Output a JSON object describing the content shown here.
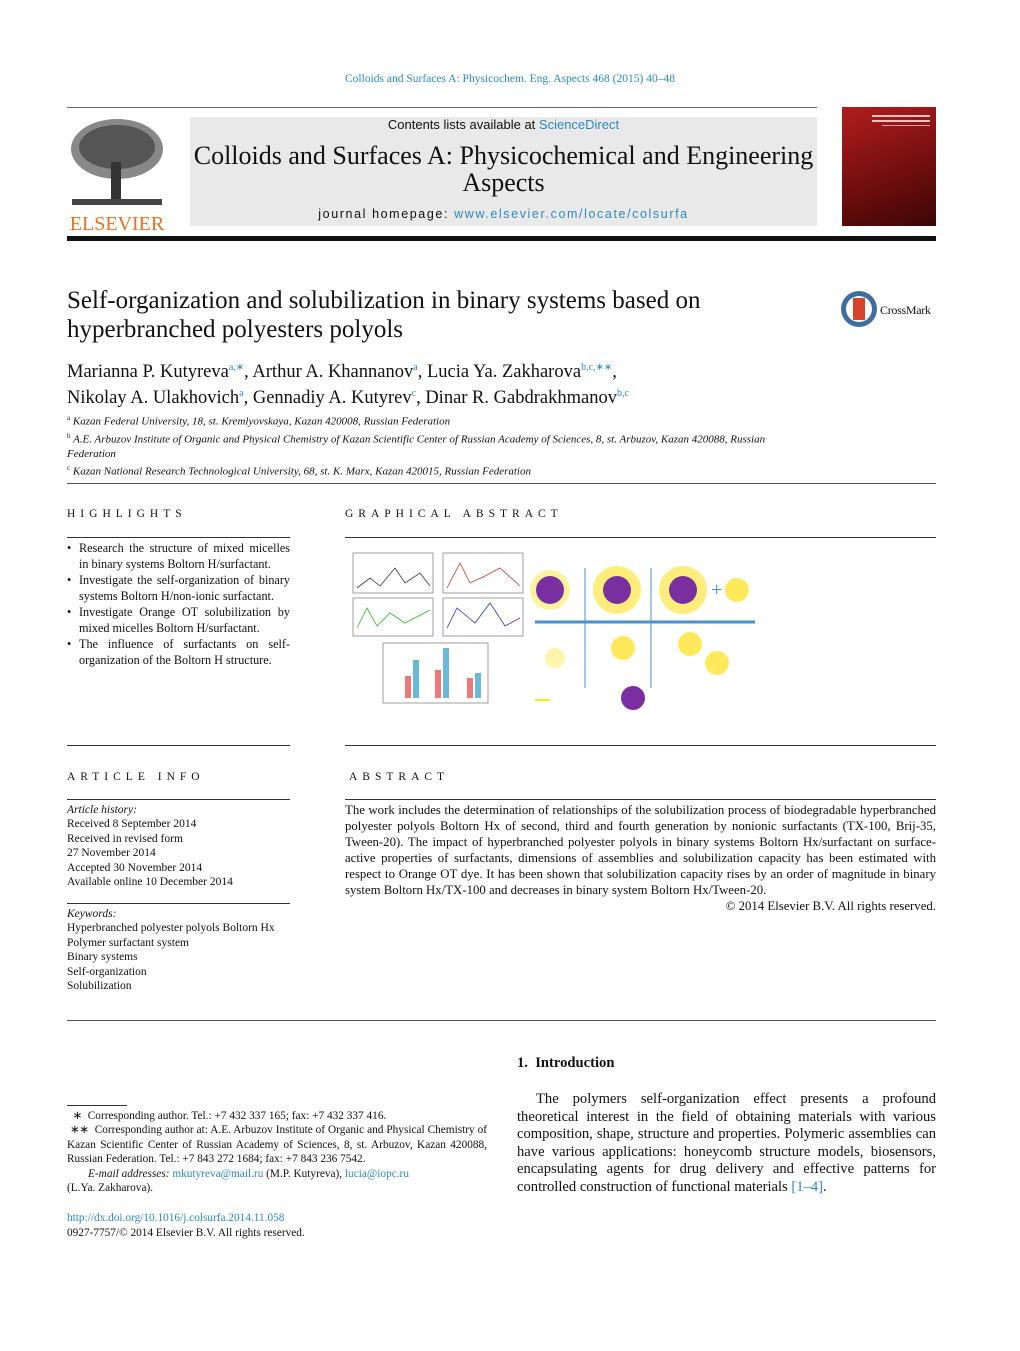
{
  "citation": "Colloids and Surfaces A: Physicochem. Eng. Aspects 468 (2015) 40–48",
  "header": {
    "contents_prefix": "Contents lists available at ",
    "sciencedirect": "ScienceDirect",
    "journal_title": "Colloids and Surfaces A: Physicochemical and Engineering Aspects",
    "homepage_prefix": "journal homepage: ",
    "homepage_url": "www.elsevier.com/locate/colsurfa",
    "publisher_logo": "ELSEVIER",
    "crossmark": "CrossMark"
  },
  "title": "Self-organization and solubilization in binary systems based on hyperbranched polyesters polyols",
  "authors": [
    {
      "name": "Marianna P. Kutyreva",
      "sup": "a,∗",
      "sep": ", "
    },
    {
      "name": "Arthur A. Khannanov",
      "sup": "a",
      "sep": ", "
    },
    {
      "name": "Lucia Ya. Zakharova",
      "sup": "b,c,∗∗",
      "sep": ","
    },
    {
      "name": "Nikolay A. Ulakhovich",
      "sup": "a",
      "sep": ", "
    },
    {
      "name": "Gennadiy A. Kutyrev",
      "sup": "c",
      "sep": ", "
    },
    {
      "name": "Dinar R. Gabdrakhmanov",
      "sup": "b,c",
      "sep": ""
    }
  ],
  "affiliations": [
    {
      "sup": "a",
      "text": "Kazan Federal University, 18, st. Kremlyovskaya, Kazan 420008, Russian Federation"
    },
    {
      "sup": "b",
      "text": "A.E. Arbuzov Institute of Organic and Physical Chemistry of Kazan Scientific Center of Russian Academy of Sciences, 8, st. Arbuzov, Kazan 420088, Russian Federation"
    },
    {
      "sup": "c",
      "text": "Kazan National Research Technological University, 68, st. K. Marx, Kazan 420015, Russian Federation"
    }
  ],
  "highlights": {
    "heading": "HIGHLIGHTS",
    "items": [
      "Research the structure of mixed micelles in binary systems Boltorn H/surfactant.",
      "Investigate the self-organization of binary systems Boltorn H/non-ionic surfactant.",
      "Investigate Orange OT solubilization by mixed micelles Boltorn H/surfactant.",
      "The influence of surfactants on self-organization of the Boltorn H structure."
    ]
  },
  "graphical_abstract": {
    "heading": "GRAPHICAL ABSTRACT"
  },
  "article_info": {
    "heading": "ARTICLE INFO",
    "history_label": "Article history:",
    "history": [
      "Received 8 September 2014",
      "Received in revised form",
      "27 November 2014",
      "Accepted 30 November 2014",
      "Available online 10 December 2014"
    ],
    "keywords_label": "Keywords:",
    "keywords": [
      "Hyperbranched polyester polyols Boltorn Hx",
      "Polymer surfactant system",
      "Binary systems",
      "Self-organization",
      "Solubilization"
    ]
  },
  "abstract": {
    "heading": "ABSTRACT",
    "text": "The work includes the determination of relationships of the solubilization process of biodegradable hyperbranched polyester polyols Boltorn Hx of second, third and fourth generation by nonionic surfactants (TX-100, Brij-35, Tween-20). The impact of hyperbranched polyester polyols in binary systems Boltorn Hx/surfactant on surface-active properties of surfactants, dimensions of assemblies and solubilization capacity has been estimated with respect to Orange OT dye. It has been shown that solubilization capacity rises by an order of magnitude in binary system Boltorn Hx/TX-100 and decreases in binary system Boltorn Hx/Tween-20.",
    "copyright": "© 2014 Elsevier B.V. All rights reserved."
  },
  "introduction": {
    "heading": "1.  Introduction",
    "text": "The polymers self-organization effect presents a profound theoretical interest in the field of obtaining materials with various composition, shape, structure and properties. Polymeric assemblies can have various applications: honeycomb structure models, biosensors, encapsulating agents for drug delivery and effective patterns for controlled construction of functional materials ",
    "ref": "[1–4]",
    "end": "."
  },
  "footnotes": {
    "fn1": "  ∗  Corresponding author. Tel.: +7 432 337 165; fax: +7 432 337 416.",
    "fn2": " ∗∗  Corresponding author at: A.E. Arbuzov Institute of Organic and Physical Chemistry of Kazan Scientific Center of Russian Academy of Sciences, 8, st. Arbuzov, Kazan 420088, Russian Federation. Tel.: +7 843 272 1684; fax: +7 843 236 7542.",
    "email_label": "E-mail addresses:",
    "email1": "mkutyreva@mail.ru",
    "email1_name": " (M.P. Kutyreva), ",
    "email2": "lucia@iopc.ru",
    "email2_name": "(L.Ya. Zakharova).",
    "doi": "http://dx.doi.org/10.1016/j.colsurfa.2014.11.058",
    "issn": "0927-7757/© 2014 Elsevier B.V. All rights reserved."
  },
  "colors": {
    "link": "#2a8ac0",
    "elsevier_orange": "#e9711c",
    "cover": "#8a1414"
  }
}
